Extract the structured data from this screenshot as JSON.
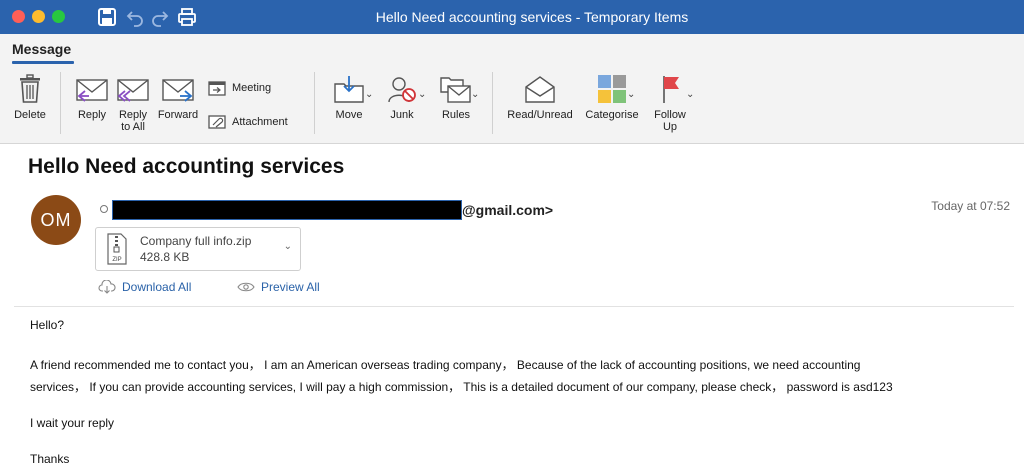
{
  "window": {
    "title": "Hello Need accounting services - Temporary Items",
    "colors": {
      "titlebar": "#2b63ad",
      "close": "#ff5f57",
      "minimize": "#febc2e",
      "maximize": "#28c840"
    }
  },
  "ribbon": {
    "active_tab": "Message",
    "buttons": {
      "delete": "Delete",
      "reply": "Reply",
      "reply_all_line1": "Reply",
      "reply_all_line2": "to All",
      "forward": "Forward",
      "meeting": "Meeting",
      "attachment": "Attachment",
      "move": "Move",
      "junk": "Junk",
      "rules": "Rules",
      "read_unread": "Read/Unread",
      "categorise": "Categorise",
      "follow_up_line1": "Follow",
      "follow_up_line2": "Up"
    }
  },
  "message": {
    "subject": "Hello Need accounting services",
    "avatar_initials": "OM",
    "avatar_color": "#8b4a16",
    "sender_domain": "@gmail.com>",
    "timestamp": "Today at 07:52",
    "attachment": {
      "name": "Company full info.zip",
      "size": "428.8 KB",
      "icon_label": "ZIP"
    },
    "actions": {
      "download_all": "Download All",
      "preview_all": "Preview All"
    },
    "body": {
      "greeting": "Hello?",
      "line1": "A friend recommended me to contact you， I am an American overseas trading company， Because of the lack of accounting positions, we need accounting",
      "line2": "services， If you can provide accounting services, I will pay a high commission， This is a detailed document of our company, please check， password is asd123",
      "wait": "I wait your reply",
      "thanks": "Thanks"
    }
  }
}
